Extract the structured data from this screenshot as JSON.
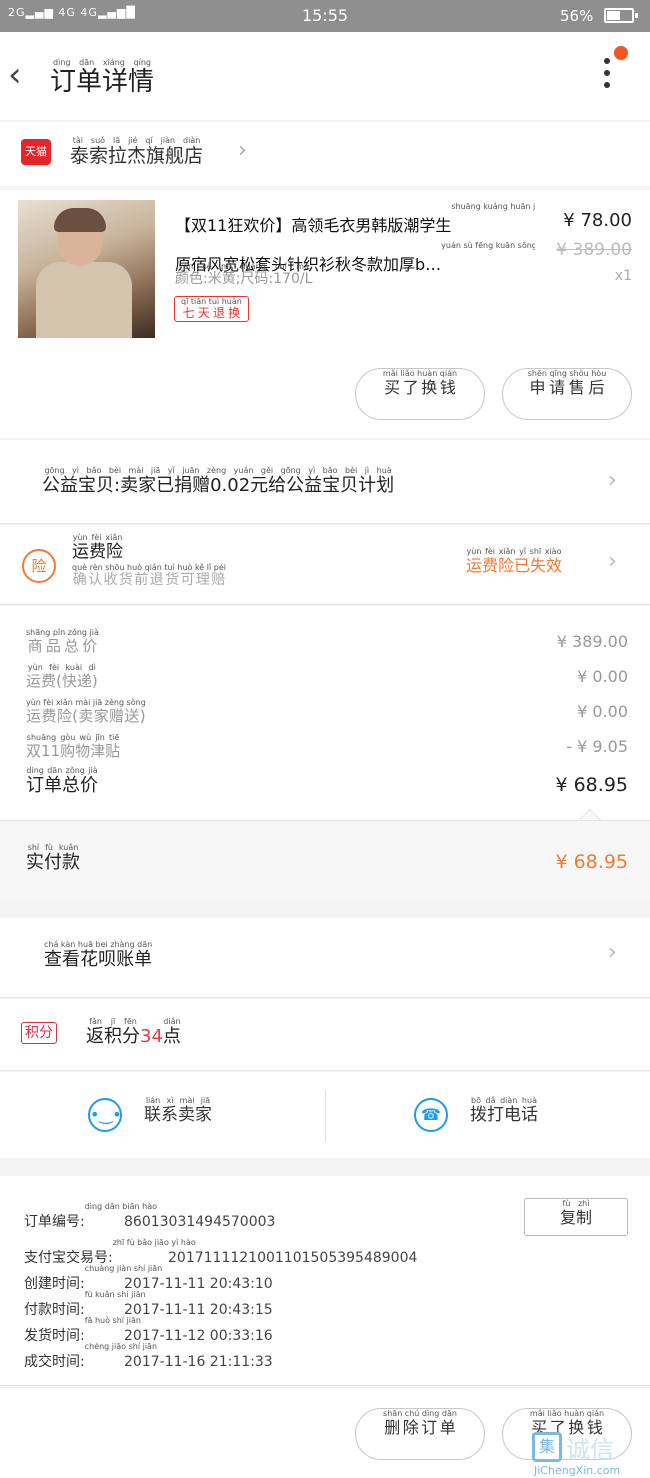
{
  "status_bar": {
    "signal_left": "2G",
    "signal_right": "4G 4G",
    "time": "15:55",
    "battery_percent": "56%",
    "battery_level": 0.56
  },
  "header": {
    "title": "订单详情",
    "title_pinyin": "dìng dān xiáng qíng",
    "back_icon": "chevron-left-icon",
    "more_icon": "more-vertical-icon",
    "notification_color": "#f5541f"
  },
  "shop": {
    "logo_text": "天猫",
    "name": "泰索拉杰旗舰店",
    "name_pinyin": "tài suǒ lā jié qí jiàn diàn"
  },
  "product": {
    "title_line1": "【双11狂欢价】高领毛衣男韩版潮学生",
    "title_line2": "原宿风宽松套头针织衫秋冬款加厚b…",
    "title_pinyin1": "shuāng kuáng huān jià  gāo lǐng máo yī nán hán bǎn cháo xué shēng",
    "title_pinyin2": "yuán sù fēng kuān sōng tào tóu zhēn zhī shān qiū dōng kuǎn jiā hòu",
    "sku": "颜色:米黄;尺码:170/L",
    "sku_pinyin": "yán sè  mǐ huáng  chǐ mǎ",
    "tag": "七天退换",
    "tag_pinyin": "qī tiān tuì huàn",
    "price": "¥ 78.00",
    "original_price": "¥ 389.00",
    "quantity": "x1",
    "btn_buy_again": "买了换钱",
    "btn_buy_again_pinyin": "mǎi liǎo huàn qián",
    "btn_after_sale": "申请售后",
    "btn_after_sale_pinyin": "shēn qǐng shòu hòu"
  },
  "charity": {
    "text": "公益宝贝:卖家已捐赠0.02元给公益宝贝计划",
    "pinyin": "gōng yì bǎo bèi  mài jiā yǐ juān zèng  yuán gěi gōng yì bǎo bèi jì huà"
  },
  "insurance": {
    "icon_text": "险",
    "title": "运费险",
    "title_pinyin": "yùn fèi xiǎn",
    "subtitle": "确认收货前退货可理赔",
    "subtitle_pinyin": "què rèn shōu huò qián tuì huò kě lǐ péi",
    "status": "运费险已失效",
    "status_pinyin": "yùn fèi xiǎn yǐ shī xiào",
    "status_color": "#f07a36"
  },
  "breakdown": {
    "rows": [
      {
        "label": "商品总价",
        "pinyin": "shāng pǐn zǒng jià",
        "value": "¥ 389.00"
      },
      {
        "label": "运费(快递)",
        "pinyin": "yùn fèi kuài dì",
        "value": "¥ 0.00"
      },
      {
        "label": "运费险(卖家赠送)",
        "pinyin": "yùn fèi xiǎn mài jiā zèng sòng",
        "value": "¥ 0.00"
      },
      {
        "label": "双11购物津贴",
        "pinyin": "shuāng gòu wù jīn tiē",
        "value": "- ¥ 9.05"
      }
    ],
    "total_label": "订单总价",
    "total_pinyin": "dìng dān zǒng jià",
    "total_value": "¥ 68.95",
    "paid_label": "实付款",
    "paid_pinyin": "shí fù kuǎn",
    "paid_value": "¥ 68.95"
  },
  "huabei": {
    "text": "查看花呗账单",
    "pinyin": "chá kàn huā bei zhàng dān"
  },
  "points": {
    "badge": "积分",
    "prefix": "返积分",
    "prefix_pinyin": "fǎn jī fēn",
    "amount": "34",
    "suffix": "点",
    "suffix_pinyin": "diǎn"
  },
  "contact": {
    "seller_label": "联系卖家",
    "seller_pinyin": "lián xì mài jiā",
    "seller_icon": "chat-bubble-icon",
    "phone_label": "拨打电话",
    "phone_pinyin": "bō dǎ diàn huà",
    "phone_icon": "phone-icon"
  },
  "order_info": {
    "copy_label": "复制",
    "copy_pinyin": "fù zhì",
    "rows": [
      {
        "label": "订单编号:",
        "pinyin": "dìng dān biān hào",
        "value": "86013031494570003"
      },
      {
        "label": "支付宝交易号:",
        "pinyin": "zhī fù bǎo jiāo yì hào",
        "value": "2017111121001101505395489004"
      },
      {
        "label": "创建时间:",
        "pinyin": "chuàng jiàn shí jiān",
        "value": "2017-11-11 20:43:10"
      },
      {
        "label": "付款时间:",
        "pinyin": "fù kuǎn shí jiān",
        "value": "2017-11-11 20:43:15"
      },
      {
        "label": "发货时间:",
        "pinyin": "fā huò shí jiān",
        "value": "2017-11-12 00:33:16"
      },
      {
        "label": "成交时间:",
        "pinyin": "chéng jiāo shí jiān",
        "value": "2017-11-16 21:11:33"
      }
    ]
  },
  "bottom_bar": {
    "delete_label": "删除订单",
    "delete_pinyin": "shān chú dìng dān",
    "rebuy_label": "买了换钱",
    "rebuy_pinyin": "mǎi liǎo huàn qián"
  },
  "watermark": {
    "mark": "集",
    "text": "诚信",
    "url": "JiChengXin.com"
  }
}
